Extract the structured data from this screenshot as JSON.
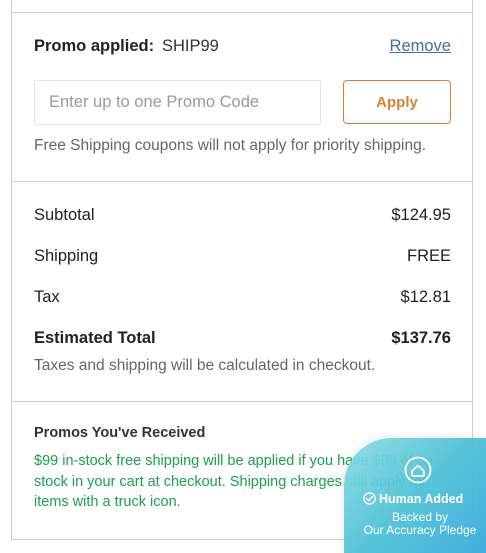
{
  "promo": {
    "applied_label": "Promo applied:",
    "applied_code": "SHIP99",
    "remove_label": "Remove",
    "input_placeholder": "Enter up to one Promo Code",
    "input_value": "",
    "apply_label": "Apply",
    "shipping_note": "Free Shipping coupons will not apply for priority shipping."
  },
  "summary": {
    "rows": [
      {
        "label": "Subtotal",
        "value": "$124.95"
      },
      {
        "label": "Shipping",
        "value": "FREE"
      },
      {
        "label": "Tax",
        "value": "$12.81"
      }
    ],
    "total_label": "Estimated Total",
    "total_value": "$137.76",
    "note": "Taxes and shipping will be calculated in checkout."
  },
  "received": {
    "title": "Promos You've Received",
    "text": "$99 in-stock free shipping will be applied if you have $99 of in-stock in your cart at checkout. Shipping charges still apply for items with a truck icon."
  },
  "badge": {
    "line1": "Human Added",
    "line2": "Backed by",
    "line3": "Our Accuracy Pledge",
    "icon": "house-shield-icon"
  },
  "colors": {
    "accent": "#d9822b",
    "link": "#3f6fa8",
    "promo_text": "#19a14d",
    "badge": "#4dc0d6"
  }
}
